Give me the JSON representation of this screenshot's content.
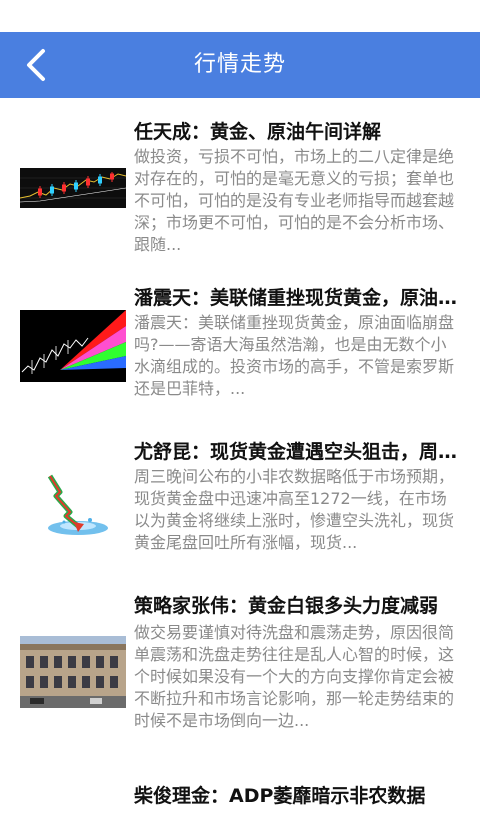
{
  "header": {
    "back_icon": "chevron-left-icon",
    "title": "行情走势",
    "color": "#4a7fe0"
  },
  "articles": [
    {
      "title": "任天成：黄金、原油午间详解",
      "summary": "做投资，亏损不可怕，市场上的二八定律是绝对存在的，可怕的是毫无意义的亏损；套单也不可怕，可怕的是没有专业老师指导而越套越深；市场更不可怕，可怕的是不会分析市场、跟随...",
      "thumbnail": "candlestick-chart-thumbnail"
    },
    {
      "title": "潘震天：美联储重挫现货黄金，原油面临崩盘吗？",
      "summary": "潘震天：美联储重挫现货黄金，原油面临崩盘吗?——寄语大海虽然浩瀚，也是由无数个小水滴组成的。投资市场的高手，不管是索罗斯还是巴菲特，...",
      "thumbnail": "fan-chart-thumbnail"
    },
    {
      "title": "尤舒昆：现货黄金遭遇空头狙击，周三晚间公布",
      "summary": "周三晚间公布的小非农数据略低于市场预期，现货黄金盘中迅速冲高至1272一线，在市场以为黄金将继续上涨时，惨遭空头洗礼，现货黄金尾盘回吐所有涨幅，现货...",
      "thumbnail": "falling-arrow-thumbnail"
    },
    {
      "title": "策略家张伟：黄金白银多头力度减弱",
      "summary": "做交易要谨慎对待洗盘和震荡走势，原因很简单震荡和洗盘走势往往是乱人心智的时候，这个时候如果没有一个大的方向支撑你肯定会被不断拉升和市场言论影响，那一轮走势结束的时候不是市场倒向一边...",
      "thumbnail": "building-thumbnail"
    },
    {
      "title": "柴俊理金：ADP萎靡暗示非农数据",
      "summary": "",
      "thumbnail": ""
    }
  ]
}
